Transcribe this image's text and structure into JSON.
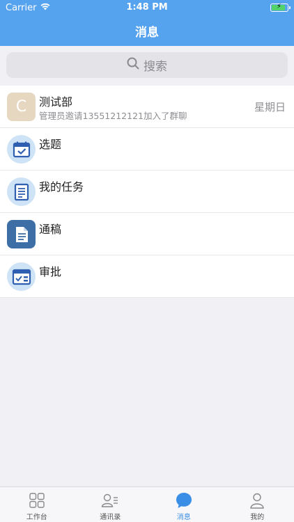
{
  "status_bar": {
    "carrier": "Carrier",
    "time": "1:48 PM"
  },
  "nav": {
    "title": "消息"
  },
  "search": {
    "placeholder": "搜索"
  },
  "messages": [
    {
      "avatar_letter": "C",
      "title": "测试部",
      "subtitle": "管理员邀请13551212121加入了群聊",
      "date": "星期日",
      "icon": "group-avatar"
    },
    {
      "title": "选题",
      "icon": "calendar-icon"
    },
    {
      "title": "我的任务",
      "icon": "task-list-icon"
    },
    {
      "title": "通稿",
      "icon": "document-icon"
    },
    {
      "title": "审批",
      "icon": "approval-icon"
    }
  ],
  "tabs": [
    {
      "label": "工作台",
      "icon": "grid-icon",
      "active": false
    },
    {
      "label": "通讯录",
      "icon": "contacts-icon",
      "active": false
    },
    {
      "label": "消息",
      "icon": "chat-icon",
      "active": true
    },
    {
      "label": "我的",
      "icon": "profile-icon",
      "active": false
    }
  ],
  "colors": {
    "header": "#55a2ee",
    "active_tab": "#3a8ee6",
    "background": "#f0f0f5"
  }
}
